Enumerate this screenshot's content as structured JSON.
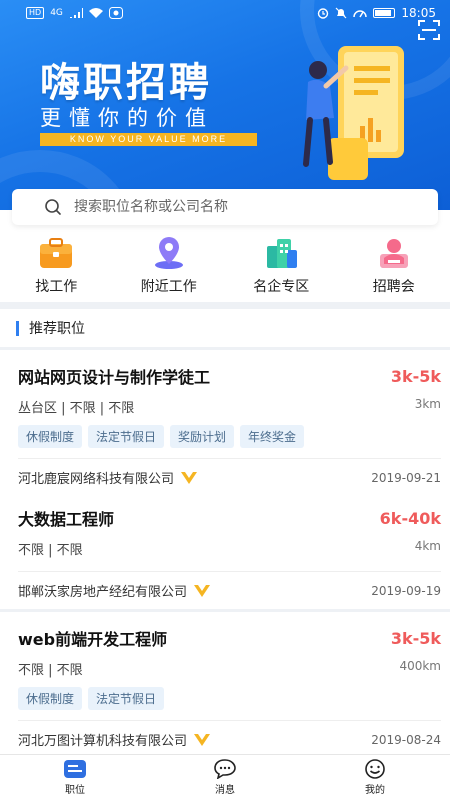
{
  "status_bar": {
    "network": "HD",
    "signal": "4G",
    "time": "18:05"
  },
  "hero": {
    "title": "嗨职招聘",
    "subtitle": "更懂你的价值",
    "tagline": "KNOW YOUR VALUE MORE",
    "colors": {
      "bg_start": "#2a8ef5",
      "bg_end": "#0d5fd6",
      "accent": "#f5b522"
    }
  },
  "search": {
    "placeholder": "搜索职位名称或公司名称"
  },
  "quick_nav": [
    {
      "label": "找工作",
      "icon": "briefcase-icon"
    },
    {
      "label": "附近工作",
      "icon": "location-pin-icon"
    },
    {
      "label": "名企专区",
      "icon": "buildings-icon"
    },
    {
      "label": "招聘会",
      "icon": "fair-icon"
    }
  ],
  "section": {
    "title": "推荐职位"
  },
  "jobs": [
    {
      "title": "网站网页设计与制作学徒工",
      "salary": "3k-5k",
      "meta": "丛台区 | 不限 | 不限",
      "distance": "3km",
      "tags": [
        "休假制度",
        "法定节假日",
        "奖励计划",
        "年终奖金"
      ],
      "company": "河北鹿宸网络科技有限公司",
      "date": "2019-09-21"
    },
    {
      "title": "大数据工程师",
      "salary": "6k-40k",
      "meta": "不限 | 不限",
      "distance": "4km",
      "tags": [],
      "company": "邯郸沃家房地产经纪有限公司",
      "date": "2019-09-19"
    },
    {
      "title": "web前端开发工程师",
      "salary": "3k-5k",
      "meta": "不限 | 不限",
      "distance": "400km",
      "tags": [
        "休假制度",
        "法定节假日"
      ],
      "company": "河北万图计算机科技有限公司",
      "date": "2019-08-24"
    }
  ],
  "bottom_nav": [
    {
      "label": "职位",
      "icon": "job-list-icon",
      "active": true
    },
    {
      "label": "消息",
      "icon": "message-icon",
      "active": false
    },
    {
      "label": "我的",
      "icon": "profile-icon",
      "active": false
    }
  ],
  "colors": {
    "primary": "#2f7ff0",
    "salary": "#ef5b5b",
    "verified": "#f5b522",
    "tag_bg": "#e9f2fb"
  }
}
